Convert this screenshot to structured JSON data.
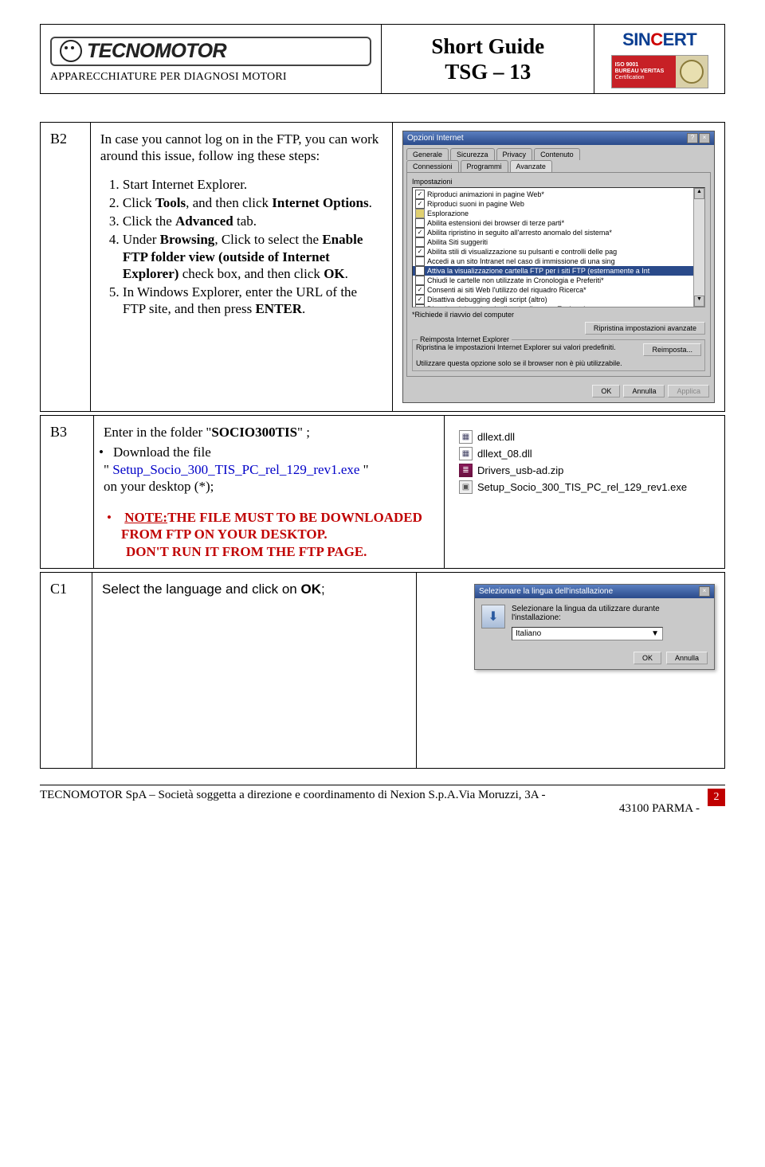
{
  "header": {
    "logo_text": "TECNOMOTOR",
    "subtitle": "APPARECCHIATURE PER DIAGNOSI MOTORI",
    "title_line1": "Short Guide",
    "title_line2": "TSG – 13",
    "sincert": "SINCERT",
    "bv_line1": "ISO 9001",
    "bv_line2": "BUREAU VERITAS",
    "bv_line3": "Certification"
  },
  "B2": {
    "label": "B2",
    "intro": "In case you cannot log on in the FTP, you can work around this issue, follow ing these steps:",
    "steps": {
      "s1": "Start Internet Explorer.",
      "s2a": "Click ",
      "s2b": "Tools",
      "s2c": ", and then click ",
      "s2d": "Internet Options",
      "s2e": ".",
      "s3a": "Click the ",
      "s3b": "Advanced",
      "s3c": " tab.",
      "s4a": "Under ",
      "s4b": "Browsing",
      "s4c": ", Click to select the ",
      "s4d": "Enable FTP folder view (outside of Internet Explorer)",
      "s4e": " check box, and then click ",
      "s4f": "OK",
      "s4g": ".",
      "s5a": "In Windows Explorer, enter the URL of the FTP site, and then press ",
      "s5b": "ENTER",
      "s5c": "."
    },
    "win": {
      "title": "Opzioni Internet",
      "tabs": [
        "Generale",
        "Sicurezza",
        "Privacy",
        "Contenuto",
        "Connessioni",
        "Programmi",
        "Avanzate"
      ],
      "group": "Impostazioni",
      "items": [
        {
          "chk": true,
          "txt": "Riproduci animazioni in pagine Web*"
        },
        {
          "chk": true,
          "txt": "Riproduci suoni in pagine Web"
        },
        {
          "cat": true,
          "txt": "Esplorazione"
        },
        {
          "chk": false,
          "txt": "Abilita estensioni dei browser di terze parti*"
        },
        {
          "chk": true,
          "txt": "Abilita ripristino in seguito all'arresto anomalo del sistema*"
        },
        {
          "chk": false,
          "txt": "Abilita Siti suggeriti"
        },
        {
          "chk": true,
          "txt": "Abilita stili di visualizzazione su pulsanti e controlli delle pag"
        },
        {
          "chk": false,
          "txt": "Accedi a un sito Intranet nel caso di immissione di una sing"
        },
        {
          "chk": true,
          "hl": true,
          "txt": "Attiva la visualizzazione cartella FTP per i siti FTP (esternamente a Int"
        },
        {
          "chk": false,
          "txt": "Chiudi le cartelle non utilizzate in Cronologia e Preferiti*"
        },
        {
          "chk": true,
          "txt": "Consenti ai siti Web l'utilizzo del riquadro Ricerca*"
        },
        {
          "chk": true,
          "txt": "Disattiva debugging degli script (altro)"
        },
        {
          "chk": true,
          "txt": "Disattiva debugging degli script (Internet Explorer)"
        }
      ],
      "note": "*Richiede il riavvio del computer",
      "btn_restore": "Ripristina impostazioni avanzate",
      "reimp_label": "Reimposta Internet Explorer",
      "reimp_txt": "Ripristina le impostazioni Internet Explorer sui valori predefiniti.",
      "reimp_btn": "Reimposta...",
      "reimp_note": "Utilizzare questa opzione solo se il browser non è più utilizzabile.",
      "ok": "OK",
      "cancel": "Annulla",
      "apply": "Applica"
    }
  },
  "B3": {
    "label": "B3",
    "t1": "Enter in the folder \"",
    "t1b": "SOCIO300TIS",
    "t1c": "\" ;",
    "t2": "Download the file",
    "t3": "\" ",
    "file": "Setup_Socio_300_TIS_PC_rel_129_rev1.exe",
    "t4": " \"",
    "t5": "on your desktop (*);",
    "note_prefix": "NOTE:",
    "note_body": "THE FILE MUST TO BE DOWNLOADED FROM FTP ON YOUR DESKTOP.",
    "note_line2": "DON'T RUN IT FROM THE FTP PAGE.",
    "files": [
      {
        "ico": "dll",
        "name": "dllext.dll"
      },
      {
        "ico": "dll",
        "name": "dllext_08.dll"
      },
      {
        "ico": "zip",
        "name": "Drivers_usb-ad.zip"
      },
      {
        "ico": "exe",
        "name": "Setup_Socio_300_TIS_PC_rel_129_rev1.exe"
      }
    ]
  },
  "C1": {
    "label": "C1",
    "t1": "Select the language and click on ",
    "t1b": "OK",
    "t1c": ";",
    "dlg_title": "Selezionare la lingua dell'installazione",
    "dlg_txt": "Selezionare la lingua da utilizzare durante l'installazione:",
    "lang": "Italiano",
    "ok": "OK",
    "cancel": "Annulla"
  },
  "footer": {
    "txt": "TECNOMOTOR SpA – Società soggetta a direzione e coordinamento di Nexion S.p.A.Via Moruzzi, 3A - 43100 PARMA -",
    "page": "2"
  }
}
